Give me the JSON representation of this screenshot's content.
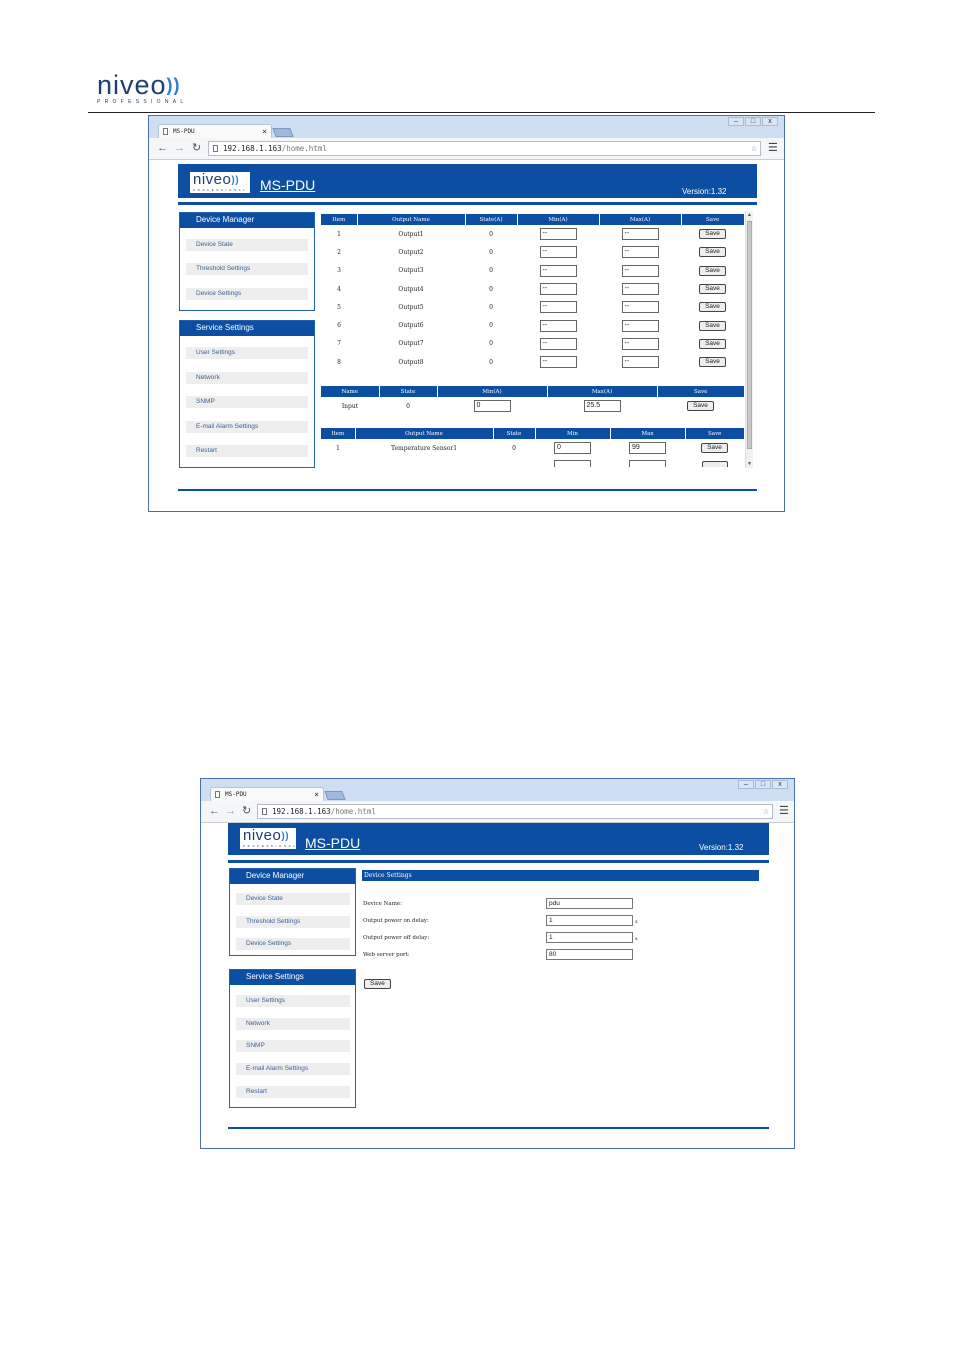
{
  "doc_header": {
    "logo_word": "nivео",
    "logo_waves": "))",
    "logo_sub": "PROFESSIONAL"
  },
  "browser": {
    "tab_title": "MS-PDU",
    "tab_close": "×",
    "url_host": "192.168.1.163",
    "url_path": "/home.html",
    "window_controls": [
      "–",
      "□",
      "x"
    ],
    "nav_icons": [
      "back-arrow-icon",
      "forward-arrow-icon",
      "reload-icon"
    ]
  },
  "app": {
    "logo_word": "nivео",
    "logo_waves": "))",
    "logo_sub": "PROFESSIONAL",
    "title": "MS-PDU",
    "version": "Version:1.32",
    "accent_color": "#0b4ea2"
  },
  "sidebar": {
    "device_manager": {
      "header": "Device Manager",
      "items": [
        "Device State",
        "Threshold Settings",
        "Device Settings"
      ]
    },
    "service_settings": {
      "header": "Service Settings",
      "items": [
        "User Settings",
        "Network",
        "SNMP",
        "E-mail Alarm Settings",
        "Restart"
      ]
    }
  },
  "threshold_page": {
    "outputs_table": {
      "headers": [
        "Item",
        "Output Name",
        "State(A)",
        "Min(A)",
        "Max(A)",
        "Save"
      ],
      "rows": [
        {
          "item": "1",
          "name": "Output1",
          "state": "0",
          "min": "--",
          "max": "--",
          "save": "Save"
        },
        {
          "item": "2",
          "name": "Output2",
          "state": "0",
          "min": "--",
          "max": "--",
          "save": "Save"
        },
        {
          "item": "3",
          "name": "Output3",
          "state": "0",
          "min": "--",
          "max": "--",
          "save": "Save"
        },
        {
          "item": "4",
          "name": "Output4",
          "state": "0",
          "min": "--",
          "max": "--",
          "save": "Save"
        },
        {
          "item": "5",
          "name": "Output5",
          "state": "0",
          "min": "--",
          "max": "--",
          "save": "Save"
        },
        {
          "item": "6",
          "name": "Output6",
          "state": "0",
          "min": "--",
          "max": "--",
          "save": "Save"
        },
        {
          "item": "7",
          "name": "Output7",
          "state": "0",
          "min": "--",
          "max": "--",
          "save": "Save"
        },
        {
          "item": "8",
          "name": "Output8",
          "state": "0",
          "min": "--",
          "max": "--",
          "save": "Save"
        }
      ]
    },
    "input_table": {
      "headers": [
        "Name",
        "State",
        "Min(A)",
        "Max(A)",
        "Save"
      ],
      "row": {
        "name": "Input",
        "state": "0",
        "min": "0",
        "max": "25.5",
        "save": "Save"
      }
    },
    "sensor_table": {
      "headers": [
        "Item",
        "Output Name",
        "State",
        "Min",
        "Max",
        "Save"
      ],
      "row": {
        "item": "1",
        "name": "Temperature Sensor1",
        "state": "0",
        "min": "0",
        "max": "99",
        "save": "Save"
      }
    }
  },
  "device_settings_page": {
    "section_title": "Device Settings",
    "fields": [
      {
        "label": "Device Name:",
        "value": "pdu",
        "unit": ""
      },
      {
        "label": "Output power on delay:",
        "value": "1",
        "unit": "s"
      },
      {
        "label": "Output power off delay:",
        "value": "1",
        "unit": "s"
      },
      {
        "label": "Web server port:",
        "value": "80",
        "unit": ""
      }
    ],
    "save_label": "Save"
  }
}
